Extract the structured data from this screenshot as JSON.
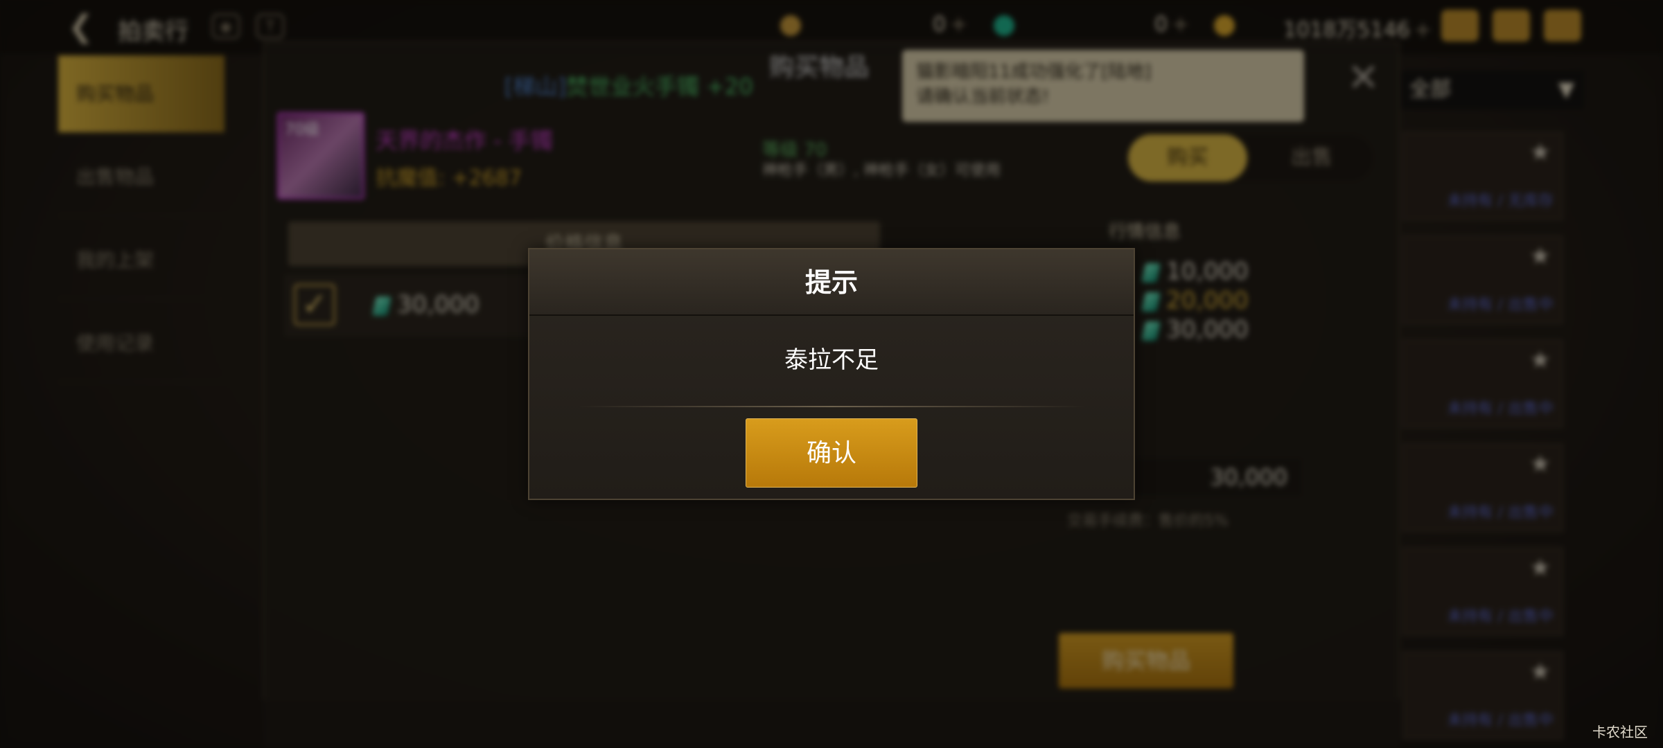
{
  "topbar": {
    "title": "拍卖行",
    "currency_c": "0",
    "currency_gem": "0",
    "gold": "1018万5146"
  },
  "sidebar": {
    "items": [
      {
        "label": "购买物品"
      },
      {
        "label": "出售物品"
      },
      {
        "label": "我的上架"
      },
      {
        "label": "使用记录"
      }
    ]
  },
  "panel": {
    "title": "购买物品",
    "announcement_server": "[梯山]",
    "announcement_text": "焚世业火手镯 +20",
    "tooltip_line1": "猫影暗阳11成功强化了[陆地]",
    "tooltip_line2": "请确认当前状态!",
    "item_level_badge": "70级",
    "item_name": "天界的杰作 - 手镯",
    "item_stat": "抗魔值: +2687",
    "item_level": "等级 70",
    "item_usable": "神枪手（男）, 神枪手（女）可使用",
    "toggle_buy": "购买",
    "toggle_sell": "出售",
    "list_header": "价格信息",
    "row_price": "30,000",
    "market_title": "行情信息",
    "market_prices": [
      "10,000",
      "20,000",
      "30,000"
    ],
    "total": "30,000",
    "fee": "交易手续费：售价的5%",
    "buy_button": "购买物品"
  },
  "right_list": {
    "filter": "全部",
    "cards": [
      {
        "status": "未持有 / 无库存"
      },
      {
        "status": "未持有 / 出售中"
      },
      {
        "status": "未持有 / 出售中"
      },
      {
        "status": "未持有 / 出售中"
      },
      {
        "status": "未持有 / 出售中"
      },
      {
        "status": "未持有 / 出售中"
      }
    ]
  },
  "modal": {
    "title": "提示",
    "message": "泰拉不足",
    "confirm": "确认"
  },
  "watermark": "卡农社区",
  "colors": {
    "accent_gold": "#d89c1c",
    "item_purple": "#c73ec9",
    "level_green": "#5fb863"
  }
}
